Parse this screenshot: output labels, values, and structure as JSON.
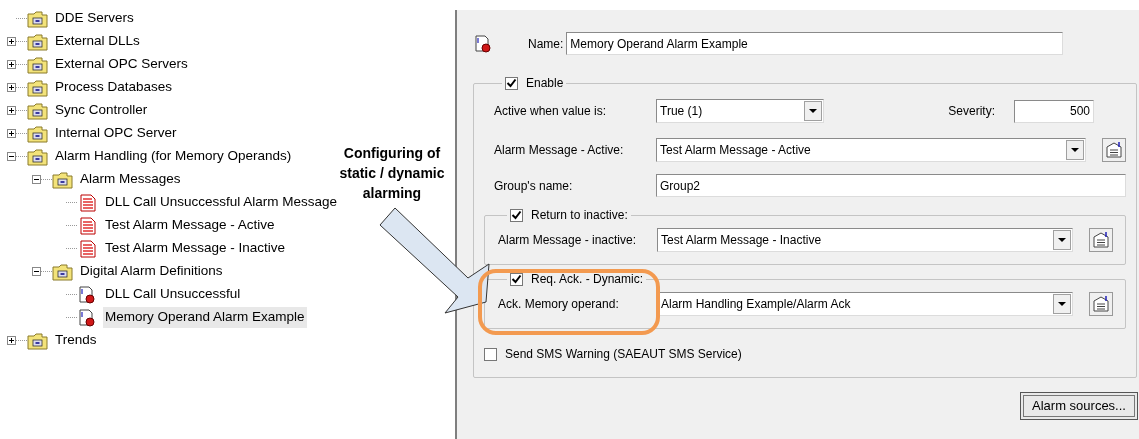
{
  "tree": [
    {
      "label": "DDE Servers",
      "kind": "folder",
      "selected": false
    },
    {
      "label": "External DLLs",
      "kind": "folder",
      "expanded": false,
      "selected": false
    },
    {
      "label": "External OPC Servers",
      "kind": "folder",
      "expanded": false,
      "selected": false
    },
    {
      "label": "Process Databases",
      "kind": "folder",
      "expanded": false,
      "selected": false
    },
    {
      "label": "Sync Controller",
      "kind": "folder",
      "expanded": false,
      "selected": false
    },
    {
      "label": "Internal OPC Server",
      "kind": "folder",
      "expanded": false,
      "selected": false
    },
    {
      "label": "Alarm Handling (for Memory Operands)",
      "kind": "folder",
      "expanded": true,
      "selected": false,
      "children": [
        {
          "label": "Alarm Messages",
          "kind": "folder",
          "expanded": true,
          "selected": false,
          "children": [
            {
              "label": "DLL Call Unsuccessful Alarm Message",
              "kind": "message",
              "selected": false
            },
            {
              "label": "Test Alarm Message - Active",
              "kind": "message",
              "selected": false
            },
            {
              "label": "Test Alarm Message - Inactive",
              "kind": "message",
              "selected": false
            }
          ]
        },
        {
          "label": "Digital Alarm Definitions",
          "kind": "folder",
          "expanded": true,
          "selected": false,
          "children": [
            {
              "label": "DLL Call Unsuccessful",
              "kind": "alarm",
              "selected": false
            },
            {
              "label": "Memory Operand Alarm Example",
              "kind": "alarm",
              "selected": true
            }
          ]
        }
      ]
    },
    {
      "label": "Trends",
      "kind": "folder",
      "expanded": false,
      "selected": false
    }
  ],
  "annotation": {
    "text": "Configuring of static / dynamic alarming"
  },
  "form": {
    "name_label": "Name:",
    "name_value": "Memory Operand Alarm Example",
    "enable": {
      "label": "Enable",
      "checked": true
    },
    "active_label": "Active when value is:",
    "active_value": "True (1)",
    "severity_label": "Severity:",
    "severity_value": "500",
    "message_active_label": "Alarm Message - Active:",
    "message_active_value": "Test Alarm Message - Active",
    "group_label": "Group's name:",
    "group_value": "Group2",
    "return_group": {
      "label": "Return to inactive:",
      "checked": true,
      "message_label": "Alarm Message - inactive:",
      "message_value": "Test Alarm Message - Inactive"
    },
    "ack_group": {
      "label": "Req. Ack. - Dynamic:",
      "checked": true,
      "operand_label": "Ack. Memory operand:",
      "operand_value": "Alarm Handling Example/Alarm Ack"
    },
    "sms": {
      "label": "Send SMS Warning (SAEAUT SMS Service)",
      "checked": false
    },
    "sources_button": "Alarm sources..."
  }
}
